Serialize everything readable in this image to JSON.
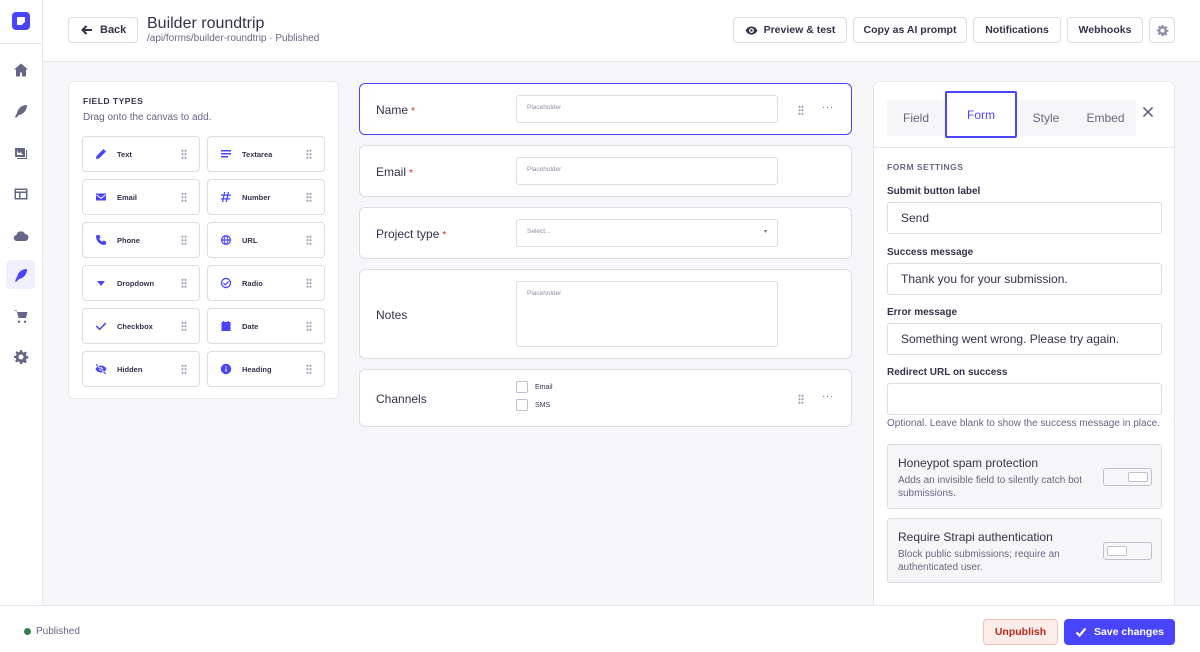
{
  "header": {
    "back_label": "Back",
    "title": "Builder roundtrip",
    "subtitle": "/api/forms/builder-roundtrip · Published",
    "buttons": {
      "preview": "Preview & test",
      "copy_prompt": "Copy as AI prompt",
      "notifications": "Notifications",
      "webhooks": "Webhooks"
    }
  },
  "field_types": {
    "title": "FIELD TYPES",
    "subtitle": "Drag onto the canvas to add.",
    "items": [
      {
        "label": "Text",
        "icon": "pencil-icon"
      },
      {
        "label": "Textarea",
        "icon": "paragraph-icon"
      },
      {
        "label": "Email",
        "icon": "envelope-icon"
      },
      {
        "label": "Number",
        "icon": "hash-icon"
      },
      {
        "label": "Phone",
        "icon": "phone-icon"
      },
      {
        "label": "URL",
        "icon": "globe-icon"
      },
      {
        "label": "Dropdown",
        "icon": "caret-down-icon"
      },
      {
        "label": "Radio",
        "icon": "radio-check-icon"
      },
      {
        "label": "Checkbox",
        "icon": "check-icon"
      },
      {
        "label": "Date",
        "icon": "calendar-icon"
      },
      {
        "label": "Hidden",
        "icon": "eye-slash-icon"
      },
      {
        "label": "Heading",
        "icon": "info-icon"
      }
    ]
  },
  "canvas": {
    "rows": [
      {
        "label": "Name",
        "required": "*",
        "placeholder": "Placeholder"
      },
      {
        "label": "Email",
        "required": "*",
        "placeholder": "Placeholder"
      },
      {
        "label": "Project type",
        "required": "*",
        "placeholder": "Select..."
      },
      {
        "label": "Notes",
        "placeholder": "Placeholder"
      },
      {
        "label": "Channels",
        "options": [
          "Email",
          "SMS"
        ]
      }
    ],
    "more_glyph": "···"
  },
  "settings": {
    "tabs": [
      "Field",
      "Form",
      "Style",
      "Embed"
    ],
    "active_tab": "Form",
    "section": "FORM SETTINGS",
    "submit_label": {
      "label": "Submit button label",
      "value": "Send"
    },
    "success": {
      "label": "Success message",
      "value": "Thank you for your submission."
    },
    "error": {
      "label": "Error message",
      "value": "Something went wrong. Please try again."
    },
    "redirect": {
      "label": "Redirect URL on success",
      "value": "",
      "hint": "Optional. Leave blank to show the success message in place."
    },
    "honeypot": {
      "title": "Honeypot spam protection",
      "desc": "Adds an invisible field to silently catch bot submissions.",
      "enabled": true
    },
    "auth": {
      "title": "Require Strapi authentication",
      "desc": "Block public submissions; require an authenticated user.",
      "enabled": false
    }
  },
  "footer": {
    "status": "Published",
    "unpublish": "Unpublish",
    "save": "Save changes"
  },
  "colors": {
    "primary": "#4945ff",
    "danger": "#d02b20",
    "success": "#328048"
  }
}
